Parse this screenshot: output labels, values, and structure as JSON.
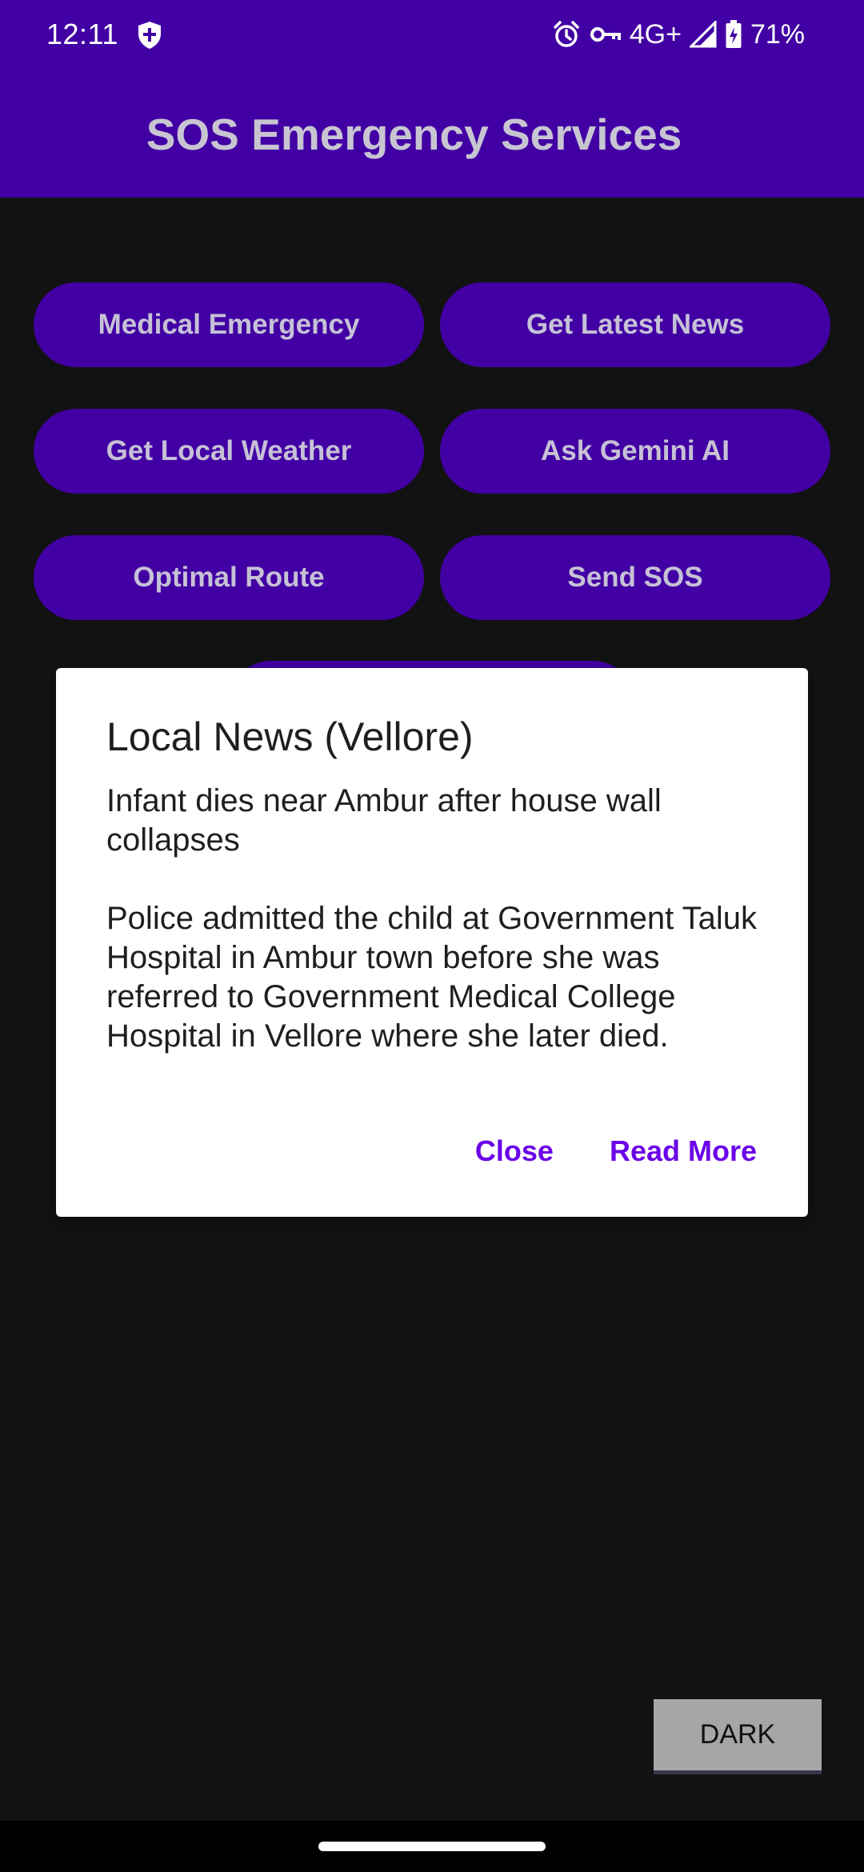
{
  "status_bar": {
    "time": "12:11",
    "network": "4G+",
    "battery_percent": "71%",
    "icons": [
      "shield-icon",
      "alarm-icon",
      "vpn-key-icon",
      "signal-icon",
      "battery-charging-icon"
    ]
  },
  "app_bar": {
    "title": "SOS Emergency Services"
  },
  "buttons": {
    "medical": "Medical Emergency",
    "news": "Get Latest News",
    "weather": "Get Local Weather",
    "gemini": "Ask Gemini AI",
    "route": "Optimal Route",
    "sos": "Send SOS"
  },
  "dialog": {
    "title": "Local News (Vellore)",
    "body": "Infant dies near Ambur after house wall collapses\n\nPolice admitted the child at Government Taluk Hospital in Ambur town before she was referred to Government Medical College Hospital in Vellore where she later died.",
    "close_label": "Close",
    "read_more_label": "Read More"
  },
  "theme_toggle": {
    "label": "DARK"
  },
  "colors": {
    "primary": "#4200A4",
    "background": "#121212",
    "dialog_accent": "#6A00E8",
    "button_text": "#C6C1D6"
  }
}
